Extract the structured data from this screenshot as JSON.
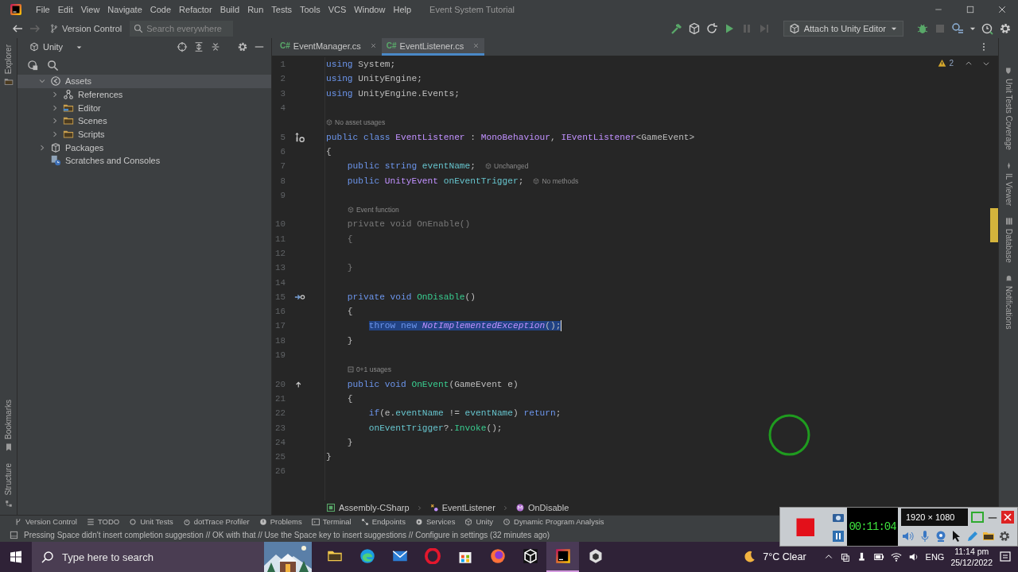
{
  "app": {
    "menu": [
      "File",
      "Edit",
      "View",
      "Navigate",
      "Code",
      "Refactor",
      "Build",
      "Run",
      "Tests",
      "Tools",
      "VCS",
      "Window",
      "Help"
    ],
    "title": "Event System Tutorial"
  },
  "toolbar": {
    "vcs": "Version Control",
    "search": {
      "placeholder": "Search everywhere"
    },
    "run_config": "Attach to Unity Editor"
  },
  "left_strip": {
    "top": [
      "Explorer"
    ],
    "bottom": [
      "Bookmarks",
      "Structure"
    ]
  },
  "explorer": {
    "view": "Unity",
    "tree": [
      {
        "label": "Assets",
        "kind": "unity",
        "expanded": true,
        "selected": true,
        "children": [
          {
            "label": "References",
            "kind": "references",
            "expanded": false,
            "selected": false
          },
          {
            "label": "Editor",
            "kind": "editor-folder",
            "expanded": false,
            "selected": false
          },
          {
            "label": "Scenes",
            "kind": "folder",
            "expanded": false,
            "selected": false
          },
          {
            "label": "Scripts",
            "kind": "folder",
            "expanded": false,
            "selected": false
          }
        ]
      },
      {
        "label": "Packages",
        "kind": "package",
        "expanded": false,
        "selected": false
      },
      {
        "label": "Scratches and Consoles",
        "kind": "scratches",
        "selected": false
      }
    ]
  },
  "editor": {
    "tabs": [
      {
        "badge": "C#",
        "label": "EventManager.cs",
        "selected": false
      },
      {
        "badge": "C#",
        "label": "EventListener.cs",
        "selected": true
      }
    ],
    "warnings": "2",
    "lines": [
      {
        "kind": "code",
        "number": "1",
        "tokens": [
          {
            "text": "using ",
            "kind": "keyword"
          },
          {
            "text": "System",
            "kind": "plain"
          },
          {
            "text": ";",
            "kind": "plain"
          }
        ]
      },
      {
        "kind": "code",
        "number": "2",
        "tokens": [
          {
            "text": "using ",
            "kind": "keyword"
          },
          {
            "text": "UnityEngine",
            "kind": "plain"
          },
          {
            "text": ";",
            "kind": "plain"
          }
        ]
      },
      {
        "kind": "code",
        "number": "3",
        "tokens": [
          {
            "text": "using ",
            "kind": "keyword"
          },
          {
            "text": "UnityEngine.Events",
            "kind": "plain"
          },
          {
            "text": ";",
            "kind": "plain"
          }
        ]
      },
      {
        "kind": "code",
        "number": "4"
      },
      {
        "kind": "asset-hint",
        "text": "No asset usages"
      },
      {
        "kind": "code",
        "number": "5",
        "tokens": [
          {
            "text": "public class ",
            "kind": "keyword"
          },
          {
            "text": "EventListener",
            "kind": "type"
          },
          {
            "text": " : ",
            "kind": "plain"
          },
          {
            "text": "MonoBehaviour",
            "kind": "type"
          },
          {
            "text": ", ",
            "kind": "plain"
          },
          {
            "text": "IEventListener",
            "kind": "type"
          },
          {
            "text": "<",
            "kind": "plain"
          },
          {
            "text": "GameEvent",
            "kind": "plain"
          },
          {
            "text": ">",
            "kind": "plain"
          }
        ]
      },
      {
        "kind": "code",
        "number": "6",
        "tokens": [
          {
            "text": "{",
            "kind": "plain"
          }
        ]
      },
      {
        "kind": "code",
        "number": "7",
        "hint": "Unchanged",
        "tokens": [
          {
            "text": "    public string ",
            "kind": "keyword"
          },
          {
            "text": "eventName",
            "kind": "field"
          },
          {
            "text": ";",
            "kind": "plain"
          }
        ]
      },
      {
        "kind": "code",
        "number": "8",
        "hint": "No methods",
        "tokens": [
          {
            "text": "    public ",
            "kind": "keyword"
          },
          {
            "text": "UnityEvent",
            "kind": "type"
          },
          {
            "text": " onEventTrigger",
            "kind": "field"
          },
          {
            "text": ";",
            "kind": "plain"
          }
        ]
      },
      {
        "kind": "code",
        "number": "9"
      },
      {
        "kind": "asset-hint",
        "text": "Event function"
      },
      {
        "kind": "code",
        "number": "10",
        "tokens": [
          {
            "text": "    private void OnEnable()",
            "kind": "dim"
          }
        ]
      },
      {
        "kind": "code",
        "number": "11",
        "tokens": [
          {
            "text": "    {",
            "kind": "dim"
          }
        ]
      },
      {
        "kind": "code",
        "number": "12"
      },
      {
        "kind": "code",
        "number": "13",
        "tokens": [
          {
            "text": "    }",
            "kind": "dim"
          }
        ]
      },
      {
        "kind": "code",
        "number": "14"
      },
      {
        "kind": "code",
        "number": "15",
        "tokens": [
          {
            "text": "    private void ",
            "kind": "keyword"
          },
          {
            "text": "OnDisable",
            "kind": "method"
          },
          {
            "text": "()",
            "kind": "plain"
          }
        ]
      },
      {
        "kind": "code",
        "number": "16",
        "tokens": [
          {
            "text": "    {",
            "kind": "plain"
          }
        ]
      },
      {
        "kind": "code",
        "number": "17",
        "caret": true,
        "tokens": [
          {
            "text": "        throw new ",
            "kind": "keyword",
            "selected": true
          },
          {
            "text": "NotImplementedException",
            "kind": "italic-type",
            "selected": true
          },
          {
            "text": "();",
            "kind": "plain",
            "selected": true
          }
        ]
      },
      {
        "kind": "code",
        "number": "18",
        "tokens": [
          {
            "text": "    }",
            "kind": "plain"
          }
        ]
      },
      {
        "kind": "code",
        "number": "19"
      },
      {
        "kind": "usages-hint",
        "text": "0+1 usages"
      },
      {
        "kind": "code",
        "number": "20",
        "tokens": [
          {
            "text": "    public void ",
            "kind": "keyword"
          },
          {
            "text": "OnEvent",
            "kind": "method"
          },
          {
            "text": "(",
            "kind": "plain"
          },
          {
            "text": "GameEvent",
            "kind": "plain"
          },
          {
            "text": " e)",
            "kind": "plain"
          }
        ]
      },
      {
        "kind": "code",
        "number": "21",
        "tokens": [
          {
            "text": "    {",
            "kind": "plain"
          }
        ]
      },
      {
        "kind": "code",
        "number": "22",
        "tokens": [
          {
            "text": "        if",
            "kind": "keyword"
          },
          {
            "text": "(e.",
            "kind": "plain"
          },
          {
            "text": "eventName",
            "kind": "field"
          },
          {
            "text": " != ",
            "kind": "plain"
          },
          {
            "text": "eventName",
            "kind": "field"
          },
          {
            "text": ") ",
            "kind": "plain"
          },
          {
            "text": "return",
            "kind": "keyword"
          },
          {
            "text": ";",
            "kind": "plain"
          }
        ]
      },
      {
        "kind": "code",
        "number": "23",
        "tokens": [
          {
            "text": "        onEventTrigger",
            "kind": "field"
          },
          {
            "text": "?.",
            "kind": "plain"
          },
          {
            "text": "Invoke",
            "kind": "method"
          },
          {
            "text": "();",
            "kind": "plain"
          }
        ]
      },
      {
        "kind": "code",
        "number": "24",
        "tokens": [
          {
            "text": "    }",
            "kind": "plain"
          }
        ]
      },
      {
        "kind": "code",
        "number": "25",
        "tokens": [
          {
            "text": "}",
            "kind": "plain"
          }
        ]
      },
      {
        "kind": "code",
        "number": "26"
      }
    ],
    "breadcrumb": [
      {
        "kind": "assembly",
        "label": "Assembly-CSharp"
      },
      {
        "kind": "class",
        "label": "EventListener"
      },
      {
        "kind": "method",
        "label": "OnDisable"
      }
    ]
  },
  "right_strip": [
    {
      "kind": "coverage",
      "label": "Unit Tests Coverage"
    },
    {
      "kind": "il",
      "label": "IL Viewer"
    },
    {
      "kind": "database",
      "label": "Database"
    },
    {
      "kind": "notifications",
      "label": "Notifications"
    }
  ],
  "tool_windows": [
    {
      "kind": "vcs",
      "label": "Version Control"
    },
    {
      "kind": "todo",
      "label": "TODO"
    },
    {
      "kind": "tests",
      "label": "Unit Tests"
    },
    {
      "kind": "profiler",
      "label": "dotTrace Profiler"
    },
    {
      "kind": "problems",
      "label": "Problems"
    },
    {
      "kind": "terminal",
      "label": "Terminal"
    },
    {
      "kind": "endpoints",
      "label": "Endpoints"
    },
    {
      "kind": "services",
      "label": "Services"
    },
    {
      "kind": "unity",
      "label": "Unity"
    },
    {
      "kind": "dpa",
      "label": "Dynamic Program Analysis"
    }
  ],
  "status": "Pressing Space didn't insert completion suggestion // OK with that // Use the Space key to insert suggestions // Configure in settings (32 minutes ago)",
  "taskbar": {
    "search": {
      "placeholder": "Type here to search"
    },
    "apps": [
      {
        "kind": "files",
        "selected": false
      },
      {
        "kind": "edge",
        "selected": false
      },
      {
        "kind": "mail",
        "selected": false
      },
      {
        "kind": "opera",
        "selected": false
      },
      {
        "kind": "store",
        "selected": false
      },
      {
        "kind": "firefox",
        "selected": false
      },
      {
        "kind": "unity",
        "selected": false
      },
      {
        "kind": "rider",
        "selected": true
      },
      {
        "kind": "hub",
        "selected": false
      }
    ],
    "weather": "7°C Clear",
    "language": "ENG",
    "time": "11:14 pm",
    "date": "25/12/2022"
  },
  "recorder": {
    "timer": "00:11:04",
    "resolution": "1920 × 1080"
  }
}
